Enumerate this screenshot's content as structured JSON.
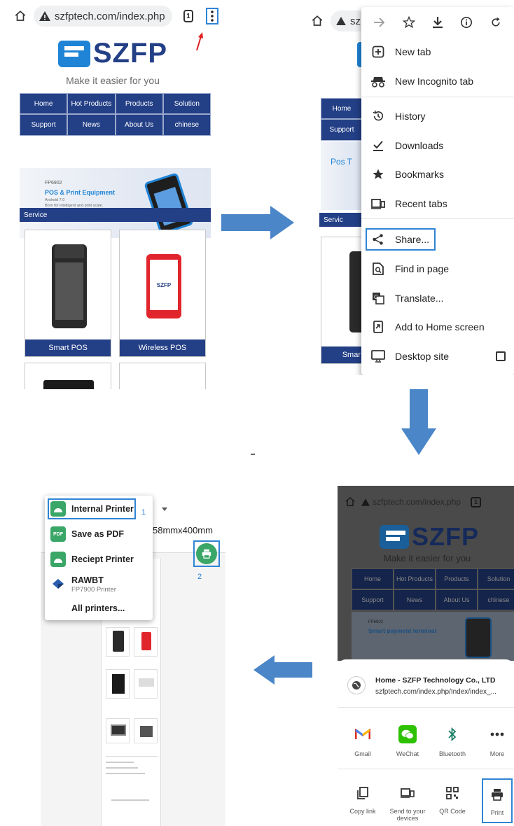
{
  "panel1": {
    "url": "szfptech.com/index.php",
    "tab_count": "1",
    "logo_text": "SZFP",
    "tagline": "Make it easier for you",
    "nav": [
      "Home",
      "Hot Products",
      "Products",
      "Solution",
      "Support",
      "News",
      "About Us",
      "chinese"
    ],
    "banner": {
      "model": "FP6902",
      "title": "POS & Print Equipment",
      "sub1": "Android 7.0",
      "sub2": "Born for intelligent and print scale."
    },
    "section": "Service",
    "products": [
      "Smart POS",
      "Wireless POS"
    ]
  },
  "panel2": {
    "partial_url": "sz",
    "nav_visible": [
      "Home",
      "Support"
    ],
    "banner_partial": "Pos T",
    "section_partial": "Servic",
    "product_partial": "Smar",
    "menu_items": [
      "New tab",
      "New Incognito tab",
      "History",
      "Downloads",
      "Bookmarks",
      "Recent tabs",
      "Share...",
      "Find in page",
      "Translate...",
      "Add to Home screen",
      "Desktop site"
    ]
  },
  "panel3": {
    "printers": [
      {
        "name": "Internal Printer",
        "sub": ""
      },
      {
        "name": "Save as PDF",
        "sub": ""
      },
      {
        "name": "Reciept Printer",
        "sub": ""
      },
      {
        "name": "RAWBT",
        "sub": "FP7900 Printer"
      },
      {
        "name": "All printers...",
        "sub": ""
      }
    ],
    "paper_size": "58mmx400mm",
    "step1": "1",
    "step2": "2",
    "pdf_badge": "PDF"
  },
  "panel4": {
    "url": "szfptech.com/index.php",
    "tab_count": "1",
    "logo_text": "SZFP",
    "tagline": "Make it easier for you",
    "nav": [
      "Home",
      "Hot Products",
      "Products",
      "Solution",
      "Support",
      "News",
      "About Us",
      "chinese"
    ],
    "banner": {
      "model": "FP6902",
      "title": "Smart payment terminal"
    },
    "share_title": "Home - SZFP Technology Co., LTD",
    "share_url": "szfptech.com/index.php/Index/index_...",
    "apps": [
      "Gmail",
      "WeChat",
      "Bluetooth",
      "More"
    ],
    "actions": [
      "Copy link",
      "Send to your devices",
      "QR Code",
      "Print"
    ]
  },
  "colors": {
    "brand_navy": "#233f86",
    "logo_blue": "#1f84d6",
    "arrow_blue": "#4a86c8",
    "highlight": "#2f84d4",
    "android_green": "#3aa667",
    "wechat_green": "#2dc100"
  }
}
